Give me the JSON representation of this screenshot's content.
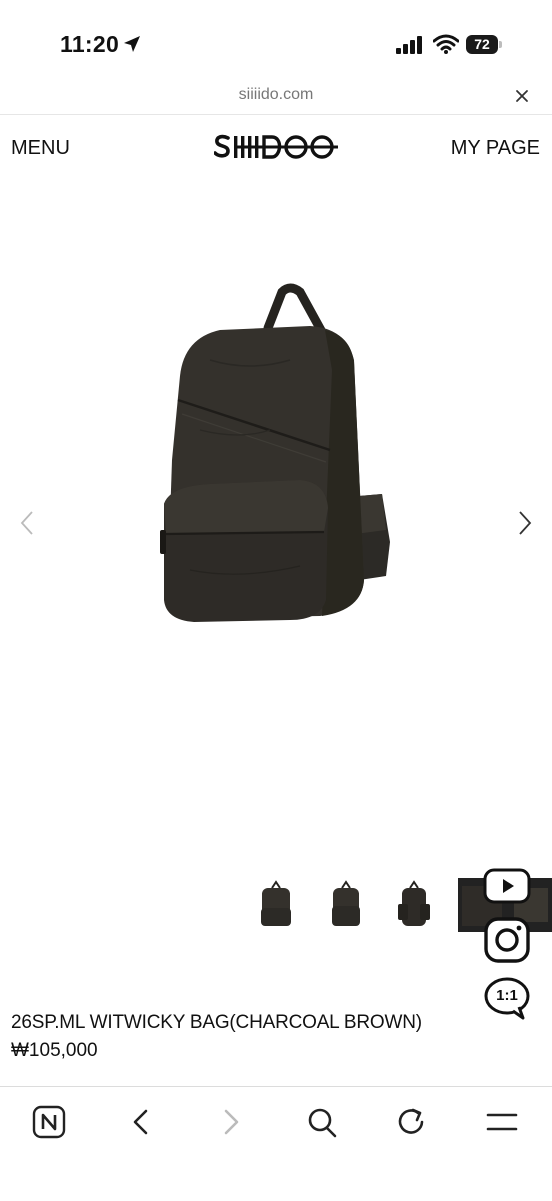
{
  "status": {
    "time": "11:20",
    "battery": "72"
  },
  "browser": {
    "url": "siiiido.com"
  },
  "header": {
    "menu_label": "MENU",
    "mypage_label": "MY PAGE",
    "logo_text": "SIIIIDOO"
  },
  "product": {
    "name": "26SP.ML WITWICKY BAG(CHARCOAL BROWN)",
    "price": "₩105,000",
    "thumbnails": [
      "thumb-front",
      "thumb-front-2",
      "thumb-side",
      "thumb-detail"
    ]
  },
  "floating": {
    "chat_label": "1:1"
  },
  "toolbar": {
    "items": [
      "naver-icon",
      "back-icon",
      "forward-icon",
      "search-icon",
      "reload-icon",
      "menu-icon"
    ]
  },
  "colors": {
    "bag": "#34312c",
    "bag_dark": "#25231f",
    "text": "#111111",
    "muted": "#777777"
  }
}
